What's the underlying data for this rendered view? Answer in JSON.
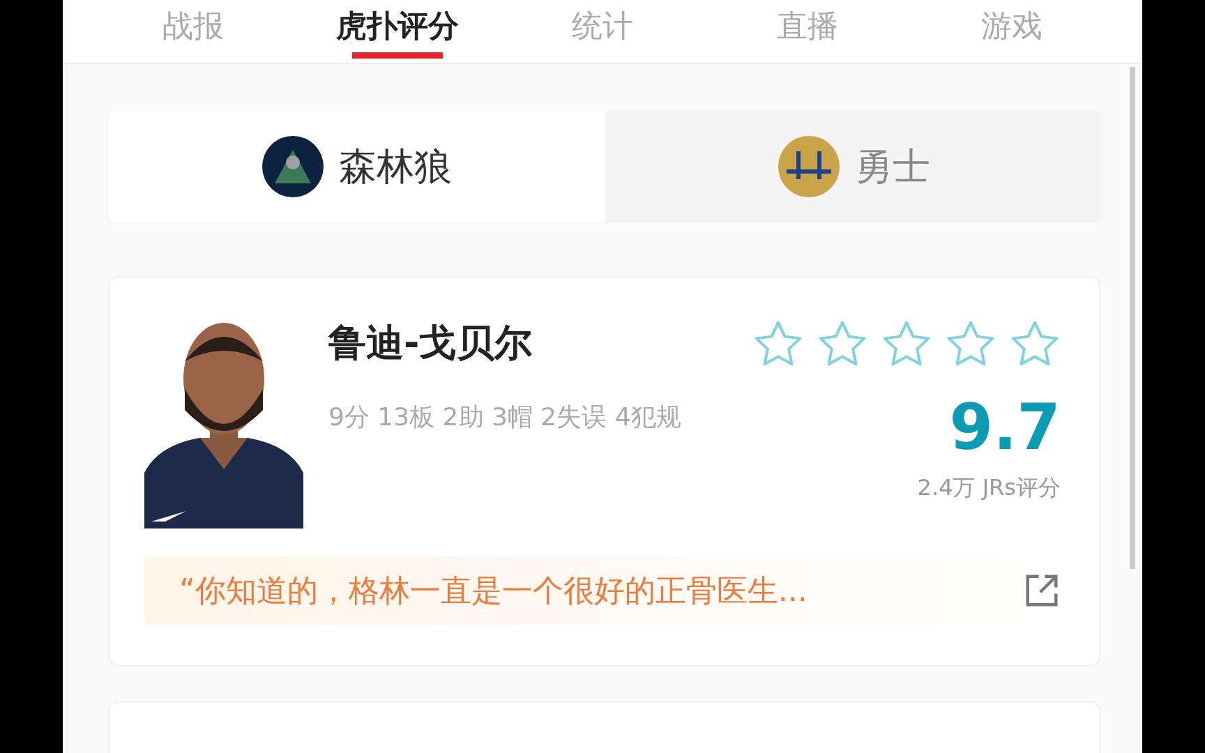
{
  "tabs": [
    {
      "label": "战报",
      "selected": false
    },
    {
      "label": "虎扑评分",
      "selected": true
    },
    {
      "label": "统计",
      "selected": false
    },
    {
      "label": "直播",
      "selected": false
    },
    {
      "label": "游戏",
      "selected": false
    }
  ],
  "teams": [
    {
      "name": "森林狼",
      "selected": true,
      "color": "#0c2340"
    },
    {
      "name": "勇士",
      "selected": false,
      "color": "#c9a44a"
    }
  ],
  "players": [
    {
      "name": "鲁迪-戈贝尔",
      "stats": "9分 13板 2助 3帽 2失误 4犯规",
      "stars": 0,
      "rating": "9.7",
      "votes": "2.4万 JRs评分",
      "quote": "“你知道的，格林一直是一个很好的正骨医生..."
    }
  ]
}
